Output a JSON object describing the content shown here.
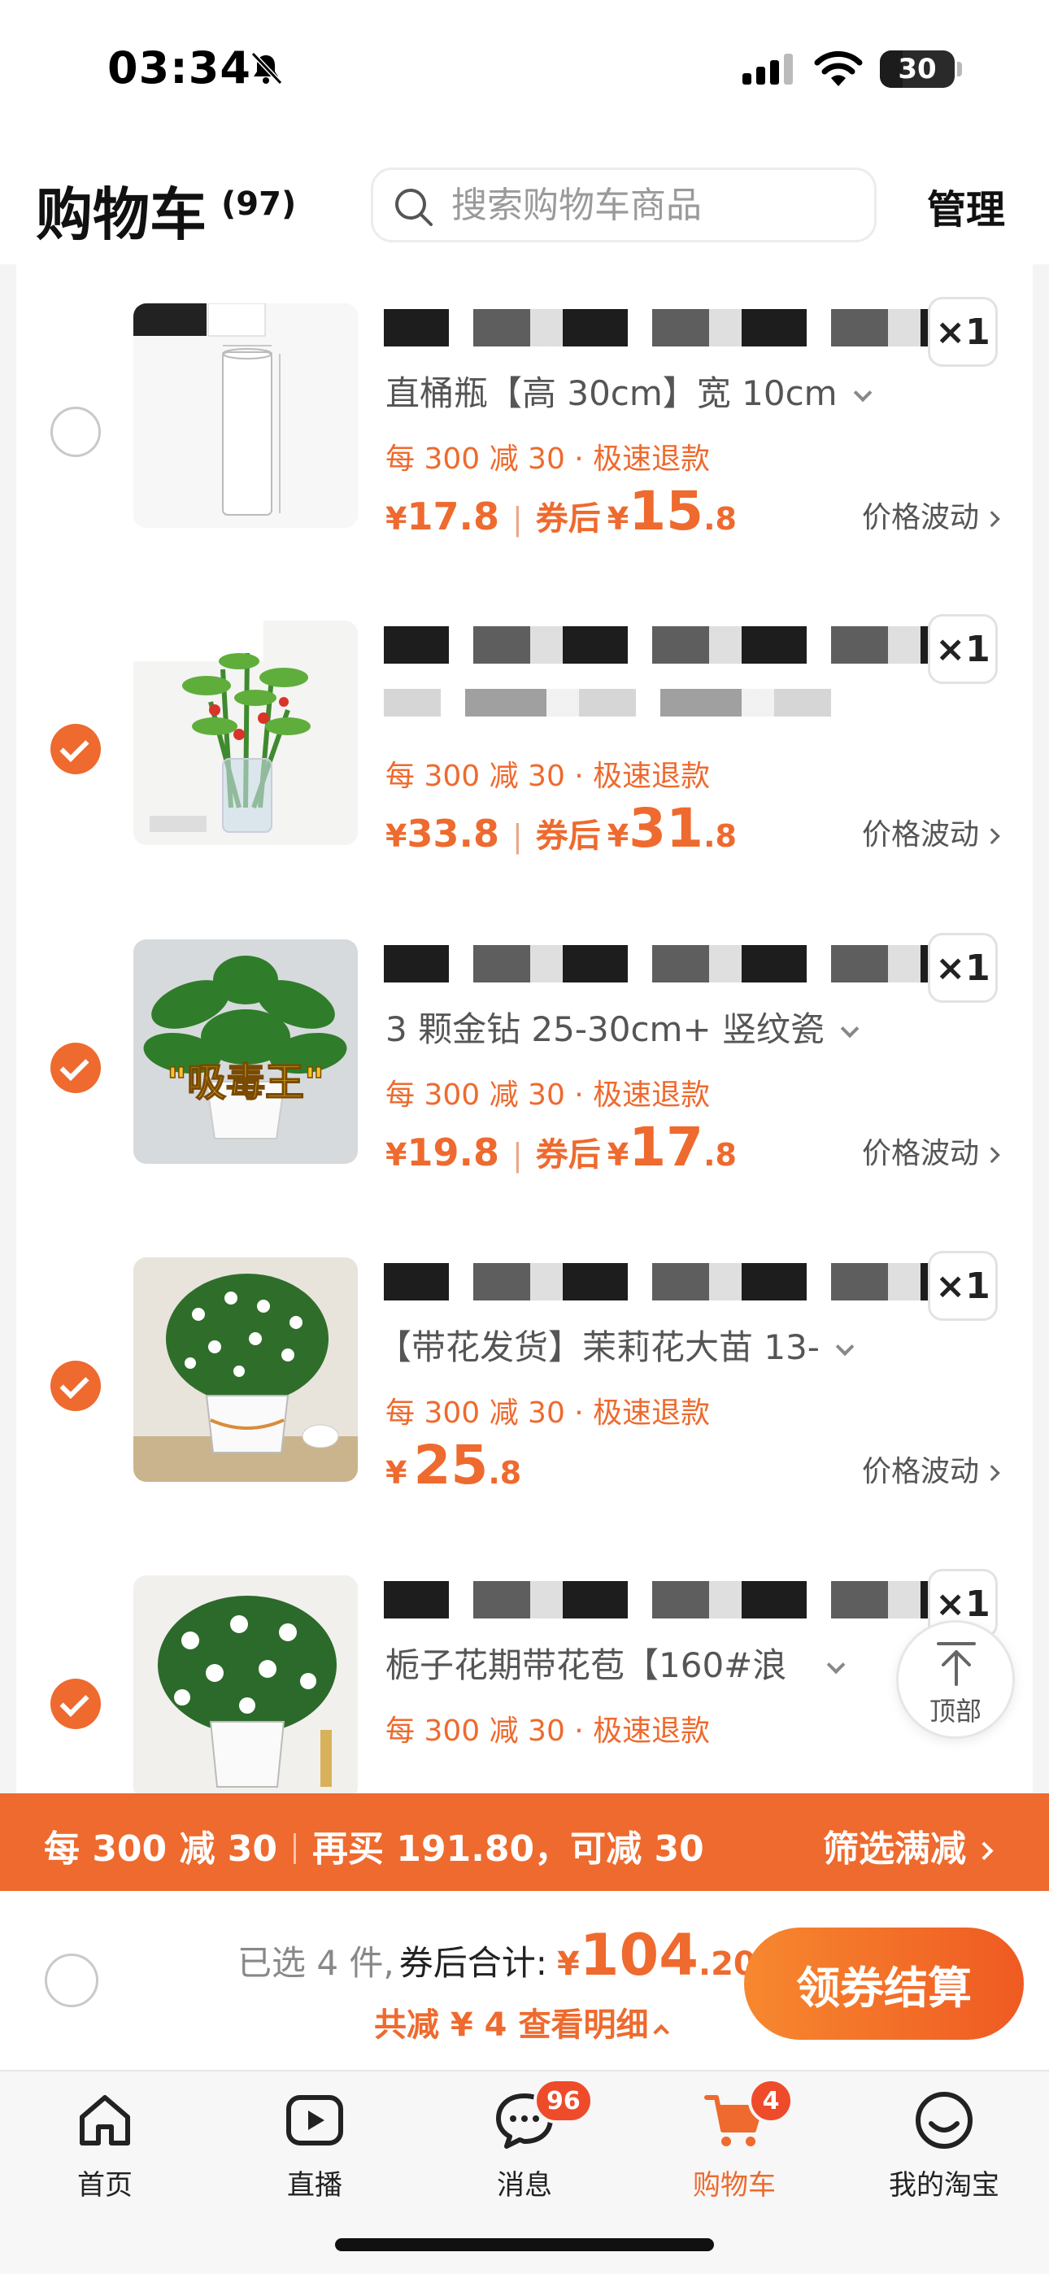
{
  "status_bar": {
    "time": "03:34",
    "battery": "30",
    "battery_level": 0.3
  },
  "header": {
    "title": "购物车",
    "count": "(97)",
    "search_placeholder": "搜索购物车商品",
    "manage_label": "管理"
  },
  "items": [
    {
      "checked": false,
      "image_label": "glass-vase",
      "qty": "×1",
      "spec": "直桶瓶【高 30cm】宽 10cm",
      "promo": "每 300 减 30 · 极速退款",
      "price": "17.8",
      "coupon_label": "券后",
      "after_int": "15",
      "after_dec": ".8",
      "yen": "¥",
      "fluct": "价格波动"
    },
    {
      "checked": true,
      "image_label": "lucky-bamboo",
      "qty": "×1",
      "spec": "",
      "promo": "每 300 减 30 · 极速退款",
      "price": "33.8",
      "coupon_label": "券后",
      "after_int": "31",
      "after_dec": ".8",
      "yen": "¥",
      "fluct": "价格波动"
    },
    {
      "checked": true,
      "image_label": "pothos-plant",
      "image_text": "\"吸毒王\"",
      "qty": "×1",
      "spec": "3 颗金钻 25-30cm+ 竖纹瓷",
      "promo": "每 300 减 30 · 极速退款",
      "price": "19.8",
      "coupon_label": "券后",
      "after_int": "17",
      "after_dec": ".8",
      "yen": "¥",
      "fluct": "价格波动"
    },
    {
      "checked": true,
      "image_label": "jasmine-plant",
      "qty": "×1",
      "spec": "【带花发货】茉莉花大苗 13-",
      "promo": "每 300 减 30 · 极速退款",
      "price": "",
      "coupon_label": "",
      "after_int": "25",
      "after_dec": ".8",
      "yen": "¥",
      "fluct": "价格波动"
    },
    {
      "checked": true,
      "image_label": "gardenia-plant",
      "qty": "×1",
      "spec": "栀子花期带花苞【160#浪",
      "promo": "每 300 减 30 · 极速退款",
      "price": "",
      "coupon_label": "",
      "after_int": "",
      "after_dec": "",
      "yen": "",
      "fluct": ""
    }
  ],
  "float_top": {
    "label": "顶部"
  },
  "banner": {
    "left_a": "每 300 减 30",
    "left_b": "再买 191.80，可减 30",
    "right": "筛选满减"
  },
  "checkout": {
    "selected": "已选 4 件,",
    "total_label": "券后合计:",
    "yen": "¥",
    "total_int": "104",
    "total_dec": ".20",
    "discount": "共减 ¥ 4  查看明细",
    "button": "领券结算"
  },
  "tabbar": {
    "tabs": [
      {
        "label": "首页",
        "icon": "home-icon"
      },
      {
        "label": "直播",
        "icon": "live-play-icon"
      },
      {
        "label": "消息",
        "icon": "message-icon",
        "badge": "96"
      },
      {
        "label": "购物车",
        "icon": "cart-icon",
        "badge": "4",
        "active": true
      },
      {
        "label": "我的淘宝",
        "icon": "profile-smile-icon"
      }
    ]
  },
  "colors": {
    "accent": "#ee6a2e",
    "badge": "#ee4b2b"
  }
}
